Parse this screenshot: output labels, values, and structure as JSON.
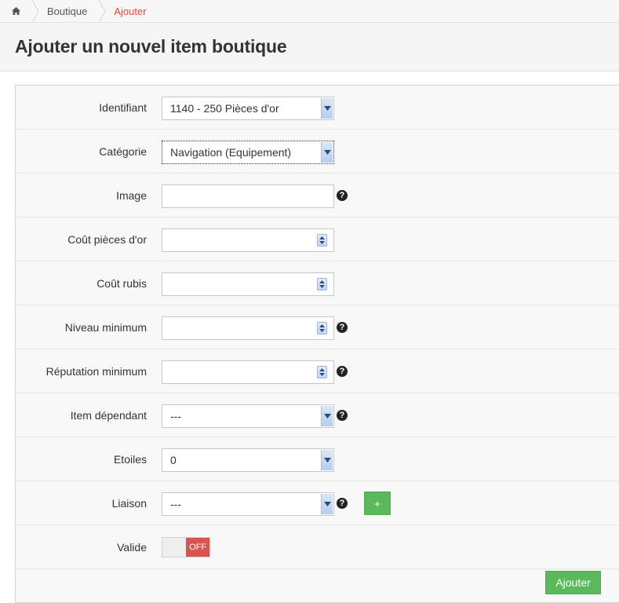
{
  "breadcrumb": {
    "home_icon": "home-icon",
    "items": [
      "Boutique",
      "Ajouter"
    ]
  },
  "header": {
    "title": "Ajouter un nouvel item boutique"
  },
  "form": {
    "identifiant": {
      "label": "Identifiant",
      "value": "1140 - 250 Pièces d'or"
    },
    "categorie": {
      "label": "Catégorie",
      "value": "Navigation (Equipement)"
    },
    "image": {
      "label": "Image",
      "value": ""
    },
    "cout_or": {
      "label": "Coût pièces d'or",
      "value": ""
    },
    "cout_rubis": {
      "label": "Coût rubis",
      "value": ""
    },
    "niveau_min": {
      "label": "Niveau minimum",
      "value": ""
    },
    "reputation_min": {
      "label": "Réputation minimum",
      "value": ""
    },
    "item_dependant": {
      "label": "Item dépendant",
      "value": "---"
    },
    "etoiles": {
      "label": "Etoiles",
      "value": "0"
    },
    "liaison": {
      "label": "Liaison",
      "value": "---",
      "add_label": "+"
    },
    "valide": {
      "label": "Valide",
      "toggle_label": "OFF"
    },
    "help_glyph": "?",
    "submit_label": "Ajouter"
  },
  "colors": {
    "accent_green": "#5cb85c",
    "off_red": "#d9534f",
    "breadcrumb_active": "#dd4b39"
  }
}
